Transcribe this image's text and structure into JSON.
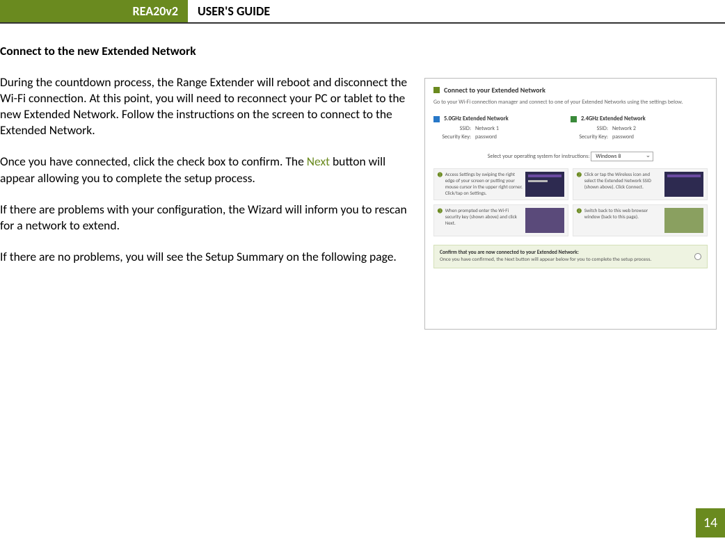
{
  "header": {
    "product": "REA20v2",
    "title": "USER'S GUIDE"
  },
  "section": {
    "heading": "Connect to the new Extended Network",
    "p1": "During the countdown process, the Range Extender will reboot and disconnect the Wi-Fi connection. At this point, you will need to reconnect your PC or tablet to the new Extended Network. Follow the instructions on the screen to connect to the Extended Network.",
    "p2a": "Once you have connected, click the check box to confirm. The ",
    "p2_next": "Next",
    "p2b": " button will appear allowing you to complete the setup process.",
    "p3": "If there are problems with your configuration, the Wizard will inform you to rescan for a network to extend.",
    "p4": "If there are no problems, you will see the Setup Summary on the following page."
  },
  "screenshot": {
    "title": "Connect to your Extended Network",
    "sub": "Go to your Wi-Fi connection manager and connect to one of your Extended Networks using the settings below.",
    "net5_title": "5.0GHz Extended Network",
    "net24_title": "2.4GHz Extended Network",
    "ssid_label": "SSID:",
    "key_label": "Security Key:",
    "net5_ssid": "Network 1",
    "net5_key": "password",
    "net24_ssid": "Network 2",
    "net24_key": "password",
    "os_label": "Select your operating system for instructions:",
    "os_value": "Windows 8",
    "step1": "Access Settings by swiping the right edge of your screen or putting your mouse cursor in the upper right corner. Click/tap on Settings.",
    "step2": "Click or tap the Wireless icon and select the Extended Network SSID (shown above). Click Connect.",
    "step3": "When prompted enter the Wi-Fi security key (shown above) and click Next.",
    "step4": "Switch back to this web browser window (back to this page).",
    "confirm_bold": "Confirm that you are now connected to your Extended Network:",
    "confirm_plain": "Once you have confirmed, the Next button will appear below for you to complete the setup process."
  },
  "page_number": "14"
}
